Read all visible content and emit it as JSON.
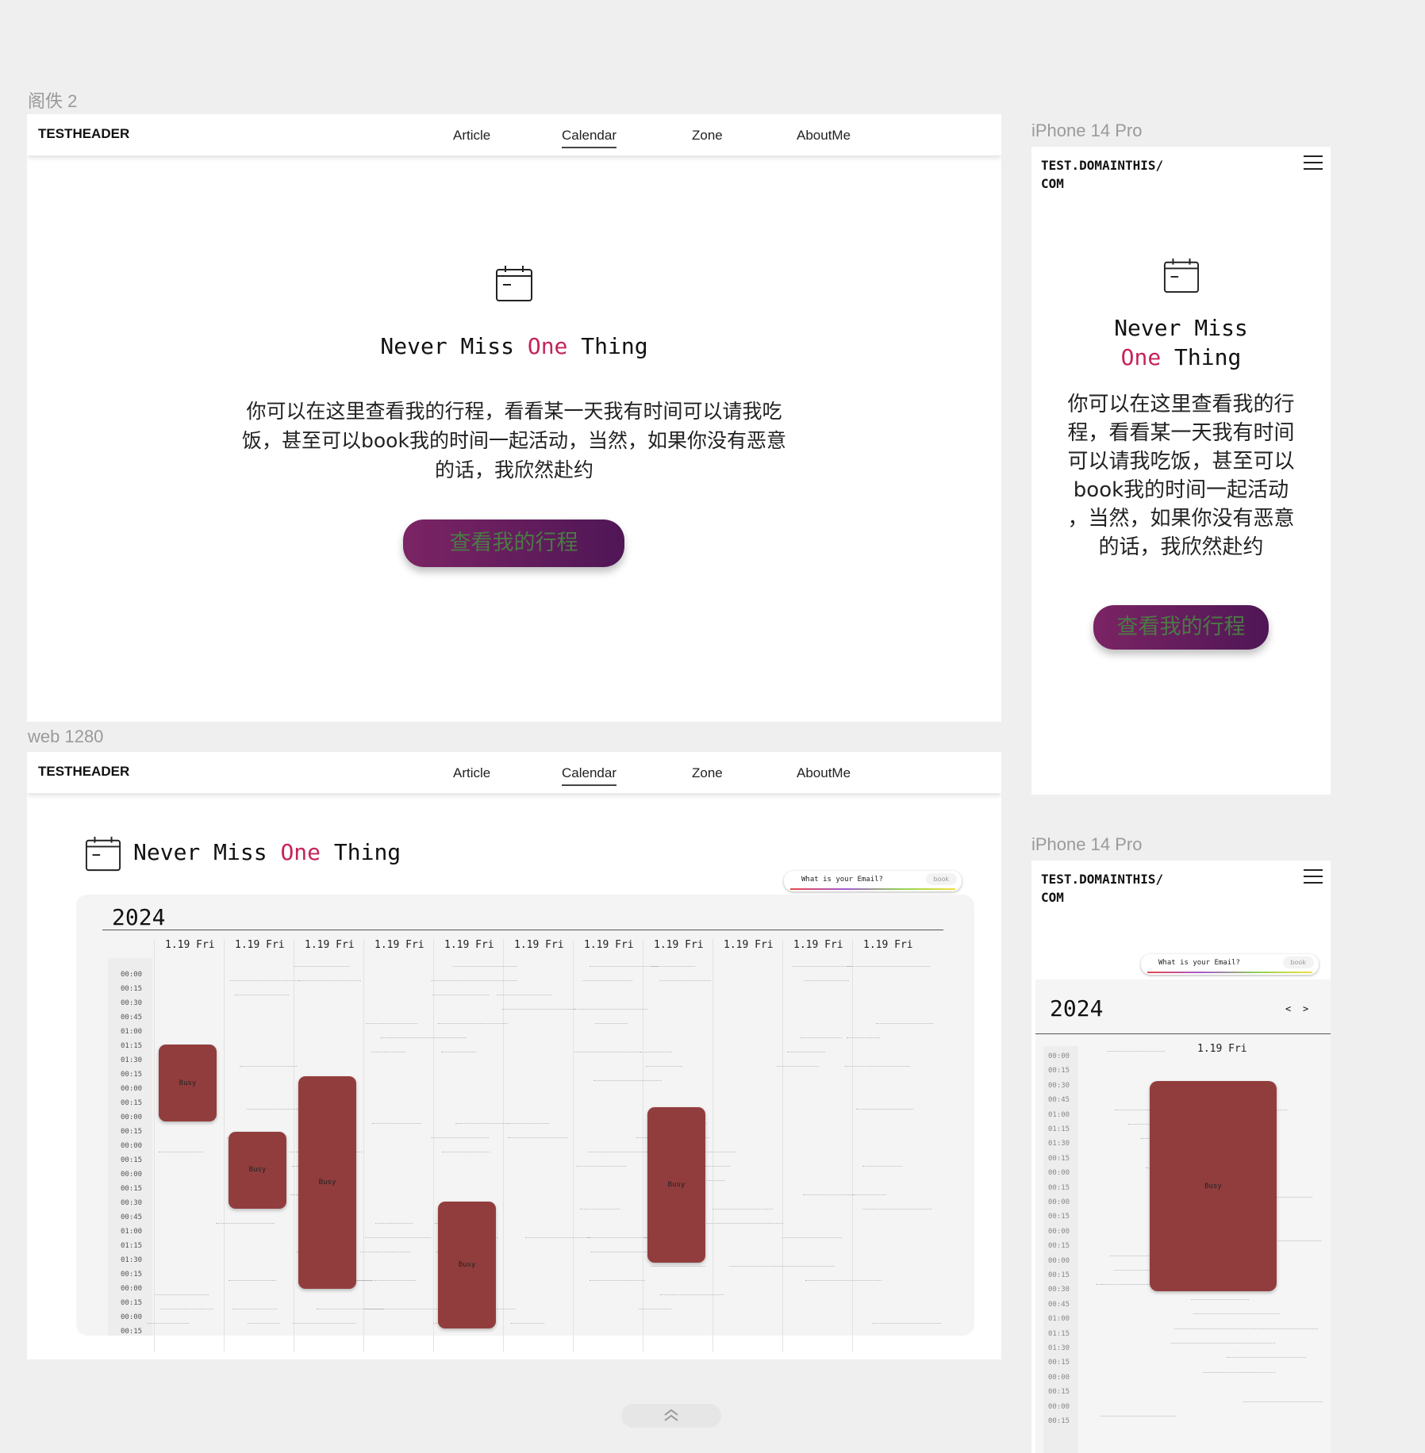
{
  "labels": {
    "frame1": "阁佚 2",
    "frame2": "web 1280",
    "frame3": "iPhone 14 Pro",
    "frame4": "iPhone 14 Pro"
  },
  "header": {
    "brand": "TESTHEADER",
    "nav": [
      "Article",
      "Calendar",
      "Zone",
      "AboutMe"
    ],
    "active": "Calendar"
  },
  "hero": {
    "title_prefix": "Never Miss ",
    "title_highlight": "One",
    "title_suffix": " Thing",
    "description": "你可以在这里查看我的行程，看看某一天我有时间可以请我吃饭，甚至可以book我的时间一起活动，当然，如果你没有恶意的话，我欣然赴约",
    "cta": "查看我的行程"
  },
  "mobile": {
    "brand_line1": "TEST.DOMAINTHIS/",
    "brand_line2": "COM",
    "title_line1": "Never Miss",
    "title_highlight": "One",
    "title_line2_suffix": " Thing",
    "desc_lines": [
      "你可以在这里查看我的行",
      "程，看看某一天我有时间",
      "可以请我吃饭，甚至可以",
      "book我的时间一起活动",
      "，当然，如果你没有恶意",
      "的话，我欣然赴约"
    ],
    "prev": "<",
    "next": ">"
  },
  "calendar": {
    "year": "2024",
    "email_placeholder": "What is your Email?",
    "book_label": "book",
    "busy_label": "Busy",
    "days": [
      "1.19 Fri",
      "1.19 Fri",
      "1.19 Fri",
      "1.19 Fri",
      "1.19 Fri",
      "1.19 Fri",
      "1.19 Fri",
      "1.19 Fri",
      "1.19 Fri",
      "1.19 Fri",
      "1.19 Fri"
    ],
    "times": [
      "00:00",
      "00:15",
      "00:30",
      "00:45",
      "01:00",
      "01:15",
      "01:30",
      "00:15",
      "00:00",
      "00:15",
      "00:00",
      "00:15",
      "00:00",
      "00:15",
      "00:00",
      "00:15",
      "00:30",
      "00:45",
      "01:00",
      "01:15",
      "01:30",
      "00:15",
      "00:00",
      "00:15",
      "00:00",
      "00:15"
    ],
    "mobile_times": [
      "00:00",
      "00:15",
      "00:30",
      "00:45",
      "01:00",
      "01:15",
      "01:30",
      "00:15",
      "00:00",
      "00:15",
      "00:00",
      "00:15",
      "00:00",
      "00:15",
      "00:00",
      "00:15",
      "00:30",
      "00:45",
      "01:00",
      "01:15",
      "01:30",
      "00:15",
      "00:00",
      "00:15",
      "00:00",
      "00:15"
    ],
    "mobile_day": "1.19 Fri"
  },
  "colors": {
    "accent": "#c4235a",
    "busy": "#923d3d",
    "cta_start": "#7b2464",
    "cta_end": "#4f1656",
    "cta_text": "#4b7a44"
  },
  "icons": [
    "calendar-icon",
    "hamburger-icon",
    "chevron-up-icon"
  ]
}
